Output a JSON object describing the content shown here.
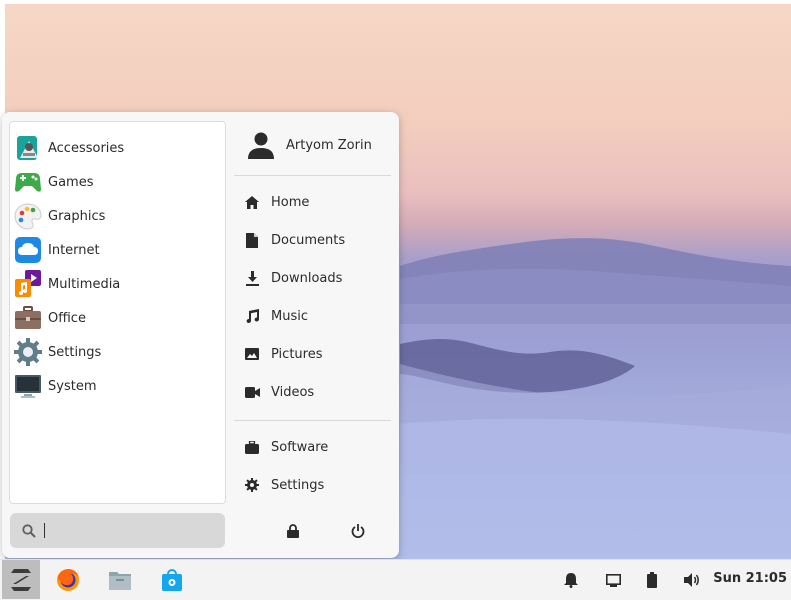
{
  "menu": {
    "categories": [
      {
        "label": "Accessories",
        "icon": "accessories-icon"
      },
      {
        "label": "Games",
        "icon": "games-icon"
      },
      {
        "label": "Graphics",
        "icon": "graphics-icon"
      },
      {
        "label": "Internet",
        "icon": "internet-icon"
      },
      {
        "label": "Multimedia",
        "icon": "multimedia-icon"
      },
      {
        "label": "Office",
        "icon": "office-icon"
      },
      {
        "label": "Settings",
        "icon": "settings-icon"
      },
      {
        "label": "System",
        "icon": "system-icon"
      }
    ],
    "search": {
      "placeholder": ""
    },
    "user": {
      "name": "Artyom Zorin",
      "icon": "user-avatar-icon"
    },
    "places": [
      {
        "label": "Home",
        "icon": "home-icon"
      },
      {
        "label": "Documents",
        "icon": "documents-icon"
      },
      {
        "label": "Downloads",
        "icon": "downloads-icon"
      },
      {
        "label": "Music",
        "icon": "music-icon"
      },
      {
        "label": "Pictures",
        "icon": "pictures-icon"
      },
      {
        "label": "Videos",
        "icon": "videos-icon"
      }
    ],
    "system": [
      {
        "label": "Software",
        "icon": "software-icon"
      },
      {
        "label": "Settings",
        "icon": "gear-icon"
      }
    ],
    "actions": [
      {
        "icon": "lock-icon"
      },
      {
        "icon": "power-icon"
      }
    ]
  },
  "taskbar": {
    "apps": [
      {
        "icon": "zorin-menu-icon"
      },
      {
        "icon": "firefox-icon"
      },
      {
        "icon": "files-icon"
      },
      {
        "icon": "software-store-icon"
      }
    ],
    "tray": [
      {
        "icon": "notifications-bell-icon"
      },
      {
        "icon": "display-icon"
      },
      {
        "icon": "battery-icon"
      },
      {
        "icon": "volume-icon"
      }
    ],
    "clock": "Sun 21:05"
  },
  "colors": {
    "accent": "#15a6f0",
    "menu_bg": "#f7f7f7",
    "taskbar_bg": "#f3f3f3"
  }
}
